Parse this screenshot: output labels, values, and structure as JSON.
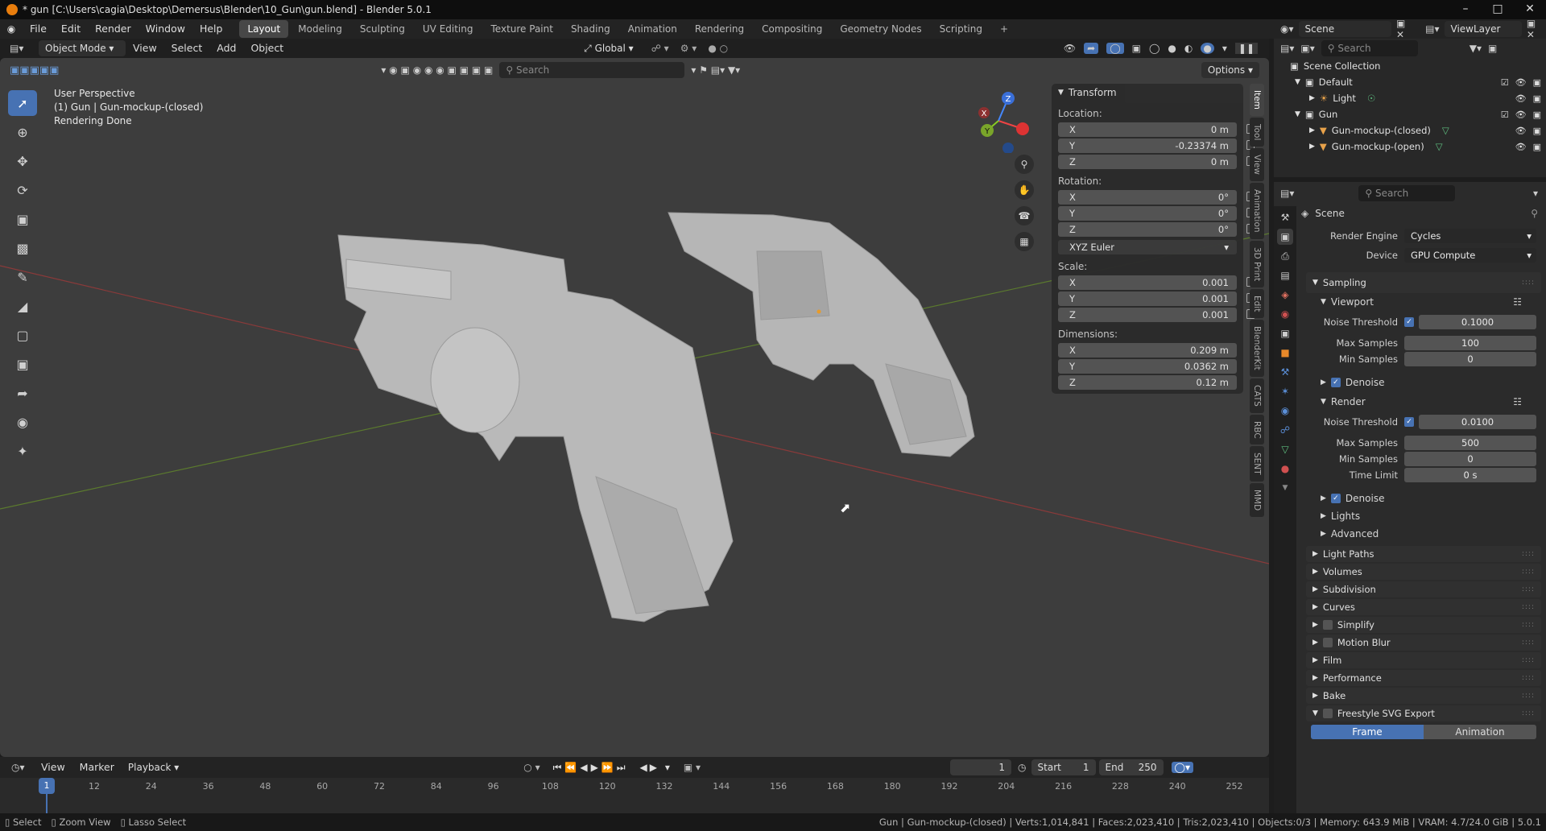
{
  "window": {
    "title": "* gun [C:\\Users\\cagia\\Desktop\\Demersus\\Blender\\10_Gun\\gun.blend] - Blender 5.0.1"
  },
  "menu": [
    "File",
    "Edit",
    "Render",
    "Window",
    "Help"
  ],
  "workspaces": [
    "Layout",
    "Modeling",
    "Sculpting",
    "UV Editing",
    "Texture Paint",
    "Shading",
    "Animation",
    "Rendering",
    "Compositing",
    "Geometry Nodes",
    "Scripting"
  ],
  "active_workspace": "Layout",
  "viewport_header": {
    "mode": "Object Mode",
    "menus": [
      "View",
      "Select",
      "Add",
      "Object"
    ],
    "orientation": "Global",
    "search_placeholder": "Search",
    "options": "Options"
  },
  "viewport_overlay": {
    "line1": "User Perspective",
    "line2": "(1) Gun | Gun-mockup-(closed)",
    "line3": "Rendering Done"
  },
  "gizmo": {
    "x": "X",
    "y": "Y",
    "z": "Z"
  },
  "transform": {
    "title": "Transform",
    "location_label": "Location:",
    "location": {
      "x": "0 m",
      "y": "-0.23374 m",
      "z": "0 m"
    },
    "rotation_label": "Rotation:",
    "rotation": {
      "x": "0°",
      "y": "0°",
      "z": "0°"
    },
    "rotation_mode": "XYZ Euler",
    "scale_label": "Scale:",
    "scale": {
      "x": "0.001",
      "y": "0.001",
      "z": "0.001"
    },
    "dimensions_label": "Dimensions:",
    "dimensions": {
      "x": "0.209 m",
      "y": "0.0362 m",
      "z": "0.12 m"
    },
    "axis": {
      "x": "X",
      "y": "Y",
      "z": "Z"
    }
  },
  "side_tabs": [
    "Item",
    "Tool",
    "View",
    "Animation",
    "3D Print",
    "Edit",
    "BlenderKit",
    "CATS",
    "RBC",
    "SENT",
    "MMD"
  ],
  "timeline": {
    "menus": [
      "View",
      "Marker",
      "Playback"
    ],
    "current_frame": "1",
    "start_label": "Start",
    "start": "1",
    "end_label": "End",
    "end": "250",
    "ticks": [
      "1",
      "12",
      "24",
      "36",
      "48",
      "60",
      "72",
      "84",
      "96",
      "108",
      "120",
      "132",
      "144",
      "156",
      "168",
      "180",
      "192",
      "204",
      "216",
      "228",
      "240",
      "252"
    ]
  },
  "statusbar": {
    "left": [
      "Select",
      "Zoom View",
      "Lasso Select"
    ],
    "right": "Gun | Gun-mockup-(closed) | Verts:1,014,841 | Faces:2,023,410 | Tris:2,023,410 | Objects:0/3 | Memory: 643.9 MiB | VRAM: 4.7/24.0 GiB | 5.0.1"
  },
  "outliner": {
    "scene": "Scene",
    "view_layer": "ViewLayer",
    "search_placeholder": "Search",
    "items": [
      {
        "label": "Scene Collection",
        "indent": 0
      },
      {
        "label": "Default",
        "indent": 1
      },
      {
        "label": "Light",
        "indent": 2
      },
      {
        "label": "Gun",
        "indent": 1
      },
      {
        "label": "Gun-mockup-(closed)",
        "indent": 2
      },
      {
        "label": "Gun-mockup-(open)",
        "indent": 2
      }
    ]
  },
  "properties": {
    "search_placeholder": "Search",
    "context": "Scene",
    "render_engine_label": "Render Engine",
    "render_engine": "Cycles",
    "device_label": "Device",
    "device": "GPU Compute",
    "sampling": "Sampling",
    "viewport": "Viewport",
    "vp_noise_label": "Noise Threshold",
    "vp_noise": "0.1000",
    "vp_max_label": "Max Samples",
    "vp_max": "100",
    "vp_min_label": "Min Samples",
    "vp_min": "0",
    "denoise": "Denoise",
    "render": "Render",
    "r_noise_label": "Noise Threshold",
    "r_noise": "0.0100",
    "r_max_label": "Max Samples",
    "r_max": "500",
    "r_min_label": "Min Samples",
    "r_min": "0",
    "r_time_label": "Time Limit",
    "r_time": "0 s",
    "lights": "Lights",
    "advanced": "Advanced",
    "sections": [
      "Light Paths",
      "Volumes",
      "Subdivision",
      "Curves",
      "Simplify",
      "Motion Blur",
      "Film",
      "Performance",
      "Bake",
      "Freestyle SVG Export"
    ],
    "frame_tab": "Frame",
    "animation_tab": "Animation"
  }
}
